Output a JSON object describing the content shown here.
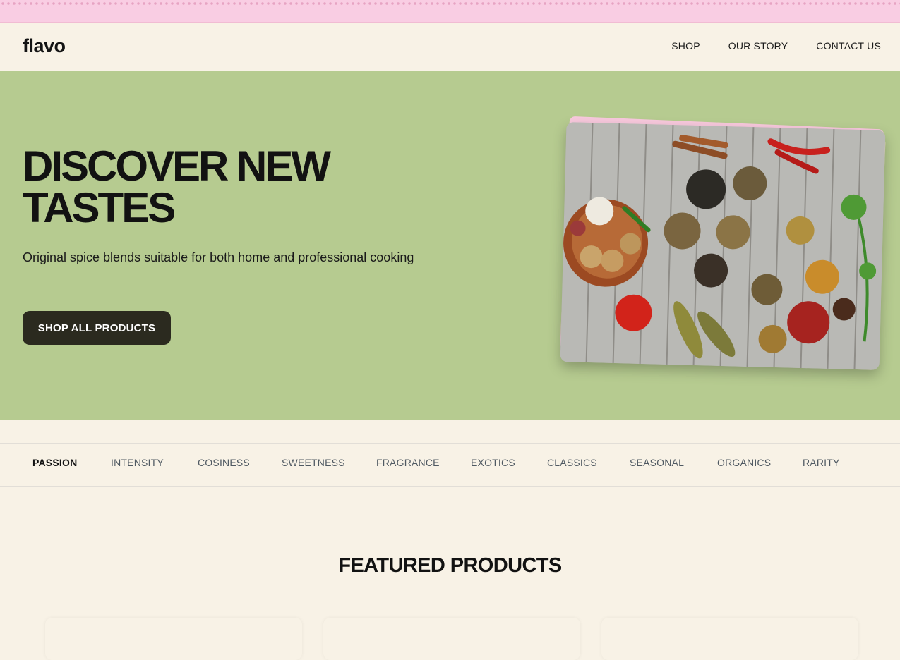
{
  "brand": {
    "logo": "flavo",
    "promo_color": "#f9cde3",
    "hero_color": "#b6cb90"
  },
  "nav": {
    "items": [
      "SHOP",
      "OUR STORY",
      "CONTACT US"
    ]
  },
  "hero": {
    "title": "DISCOVER NEW TASTES",
    "subtitle": "Original spice blends suitable for both home and professional cooking",
    "cta": "SHOP ALL PRODUCTS",
    "image_alt": "Assorted spices, chillies, garlic and ginger on a wooden table"
  },
  "tabs": {
    "active": "PASSION",
    "items": [
      "PASSION",
      "INTENSITY",
      "COSINESS",
      "SWEETNESS",
      "FRAGRANCE",
      "EXOTICS",
      "CLASSICS",
      "SEASONAL",
      "ORGANICS",
      "RARITY"
    ]
  },
  "featured": {
    "title": "FEATURED PRODUCTS"
  }
}
